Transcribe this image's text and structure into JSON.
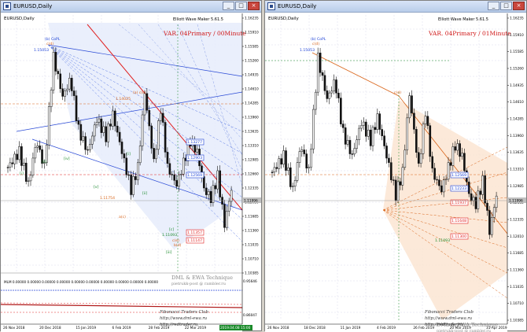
{
  "windows": [
    {
      "title": "EURUSD,Daily",
      "symbol_label": "EURUSD,Daily",
      "indicator_name": "Elliott Wave Maker 5.61.5",
      "variant": "VAR. 04Primary / 00Minute",
      "watermark_line1": "DML & EWA Technique",
      "watermark_line2": "pietrukk-post @ rambler.ru",
      "footer_line1": "Fibonacci  Traders  Club",
      "footer_line2": "http://www.dml-ewa.ru",
      "footer_line3": "http://redtrader.ru",
      "price_axis": [
        "1.16235",
        "1.15910",
        "1.15585",
        "1.15260",
        "1.14935",
        "1.14610",
        "1.14285",
        "1.13960",
        "1.13635",
        "1.13310",
        "1.12985",
        "1.12660",
        "1.12335",
        "1.12010",
        "1.11685",
        "1.11360",
        "1.11035",
        "1.10710",
        "1.10385"
      ],
      "current_price": "1.11996",
      "date_axis": [
        "26 Nov 2018",
        "20 Dec 2018",
        "15 Jan 2019",
        "6 Feb 2019",
        "28 Feb 2019",
        "22 Mar 2019",
        "2019.04.08 15:00"
      ],
      "sub_label": "MLM 0.00000 0.00000 0.00000 0.00000 0.00000 0.00000 0.00000 0.00000 0.00000 0.00000",
      "sub_axis": [
        "0.95646",
        "0.86047"
      ],
      "wave_labels": [
        "(b) CoPL",
        "c(d)",
        "1.15053",
        "1.14025",
        "(a) c(c)",
        "1.11754",
        "a(c)",
        "1.11093",
        "[c]",
        "c(e)",
        "b(d)",
        "[i]",
        "[ii]",
        "[iv]",
        "[v]",
        "[i]",
        "[ii]",
        "[iii]"
      ],
      "price_tags": [
        "1.13277",
        "1.12903",
        "1.12569",
        "1.11357",
        "1.11147"
      ]
    },
    {
      "title": "EURUSD,Daily",
      "symbol_label": "EURUSD,Daily",
      "indicator_name": "Elliott Wave Maker 5.61.5",
      "variant": "VAR. 04Primary / 01Minute",
      "watermark_line1": "DML & EWA Technique",
      "watermark_line2": "pietrukk-post @ rambler.ru",
      "footer_line1": "Fibonacci  Traders  Club",
      "footer_line2": "http://www.dml-ewa.ru",
      "footer_line3": "http://redtrader.ru",
      "price_axis": [
        "1.16235",
        "1.15910",
        "1.15585",
        "1.15260",
        "1.14935",
        "1.14610",
        "1.14285",
        "1.13960",
        "1.13635",
        "1.13310",
        "1.12985",
        "1.12660",
        "1.12335",
        "1.12010",
        "1.11685",
        "1.11360",
        "1.11035",
        "1.10710",
        "1.10385"
      ],
      "current_price": "1.11996",
      "date_axis": [
        "26 Nov 2018",
        "18 Dec 2018",
        "11 Jan 2019",
        "4 Feb 2019",
        "26 Feb 2019",
        "20 Mar 2019",
        "31 Apr 2019"
      ],
      "wave_labels": [
        "(b) CoPL",
        "c(d)",
        "1.15053",
        "c(d)",
        "1.11093"
      ],
      "price_tags": [
        "1.12569",
        "1.12233",
        "1.11937",
        "1.11648",
        "1.11300"
      ]
    }
  ],
  "colors": {
    "candle": "#111111",
    "blue": "#1a3fd6",
    "red": "#e02020",
    "orange": "#d9651a",
    "green": "#1a8a2a",
    "grid": "#c8c8e0"
  }
}
